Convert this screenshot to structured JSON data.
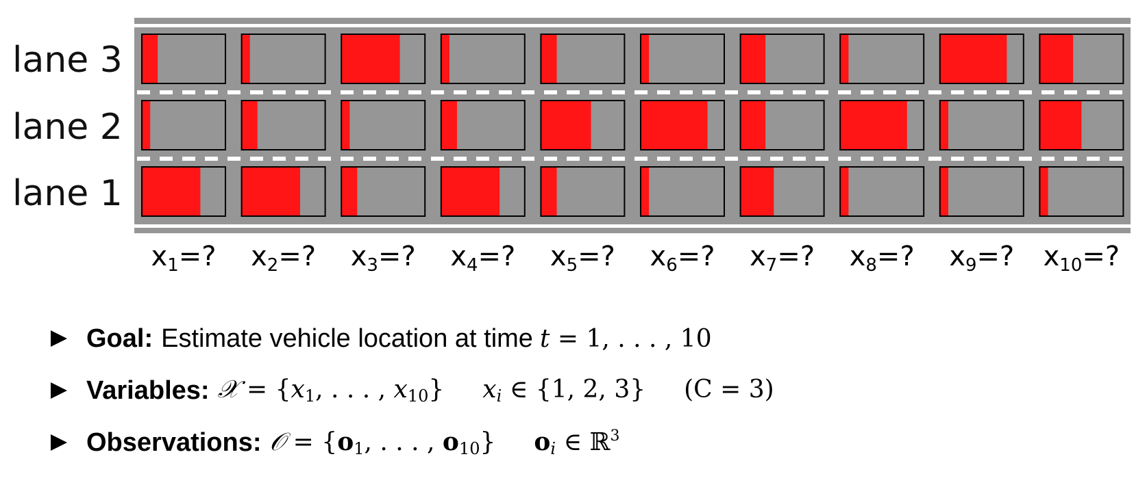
{
  "diagram": {
    "lanes": [
      "lane 3",
      "lane 2",
      "lane 1"
    ],
    "time_labels": [
      "1",
      "2",
      "3",
      "4",
      "5",
      "6",
      "7",
      "8",
      "9",
      "10"
    ],
    "label_prefix": "x",
    "label_suffix": "=?",
    "colors": {
      "road": "#969696",
      "observation": "#ff1515",
      "cell_border": "#000000",
      "lane_marking": "#ffffff"
    },
    "observations": {
      "lane 3": [
        0.19,
        0.1,
        0.7,
        0.1,
        0.19,
        0.1,
        0.3,
        0.1,
        0.8,
        0.4
      ],
      "lane 2": [
        0.1,
        0.19,
        0.1,
        0.19,
        0.6,
        0.8,
        0.3,
        0.8,
        0.1,
        0.5
      ],
      "lane 1": [
        0.7,
        0.7,
        0.19,
        0.7,
        0.19,
        0.1,
        0.4,
        0.1,
        0.1,
        0.1
      ]
    }
  },
  "bullets": {
    "goal": {
      "label": "Goal:",
      "text": "Estimate vehicle location at time",
      "var": "t",
      "range": " = 1, . . . , 10"
    },
    "variables": {
      "label": "Variables:",
      "set": "𝒳",
      "set_open": " = {",
      "x": "x",
      "s1": "1",
      "dots": ", . . . , ",
      "s10": "10",
      "set_close": "}",
      "xi": "x",
      "i": "i",
      "domain": " ∈ {1, 2, 3}",
      "classes": "(C = 3)"
    },
    "observations": {
      "label": "Observations:",
      "set": "𝒪",
      "set_open": " = {",
      "o": "o",
      "s1": "1",
      "dots": ", . . . , ",
      "s10": "10",
      "set_close": "}",
      "oi": "o",
      "i": "i",
      "domain": " ∈ ℝ",
      "exp": "3"
    }
  }
}
